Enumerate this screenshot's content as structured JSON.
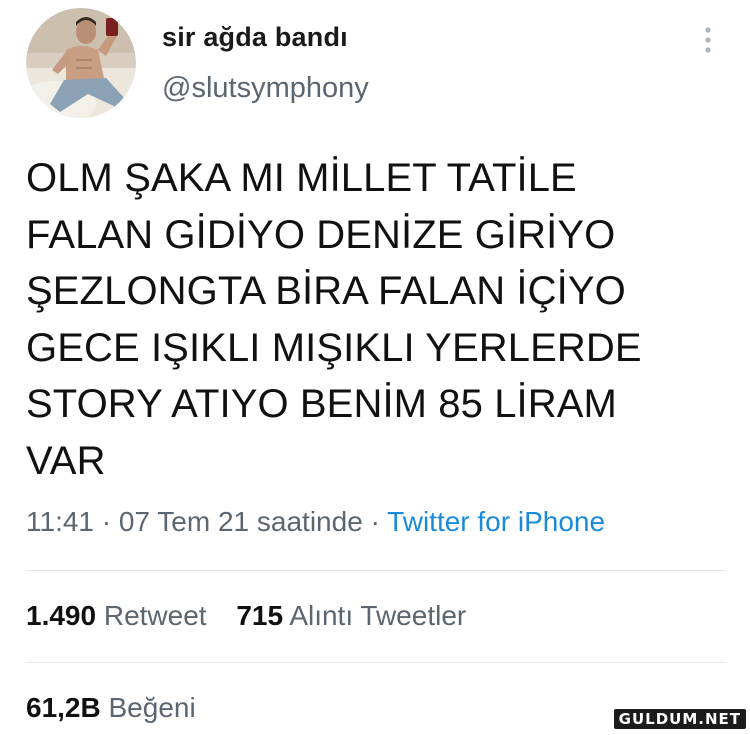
{
  "author": {
    "display_name": "sir ağda bandı",
    "handle": "@slutsymphony"
  },
  "tweet": {
    "text": "OLM ŞAKA MI MİLLET TATİLE\nFALAN GİDİYO DENİZE GİRİYO\nŞEZLONGTA BİRA FALAN İÇİYO\nGECE IŞIKLI MIŞIKLI YERLERDE\nSTORY ATIYO BENİM 85 LİRAM\nVAR",
    "time": "11:41",
    "separator": "·",
    "date": "07 Tem 21 saatinde",
    "source": "Twitter for iPhone"
  },
  "stats": {
    "retweets_count": "1.490",
    "retweets_label": "Retweet",
    "quotes_count": "715",
    "quotes_label": "Alıntı Tweetler",
    "likes_count": "61,2B",
    "likes_label": "Beğeni"
  },
  "watermark": "GULDUM.NET",
  "icons": {
    "more": "more-vertical-icon"
  },
  "colors": {
    "link": "#1b8bd9",
    "secondary_text": "#5b6670",
    "primary_text": "#111111"
  }
}
